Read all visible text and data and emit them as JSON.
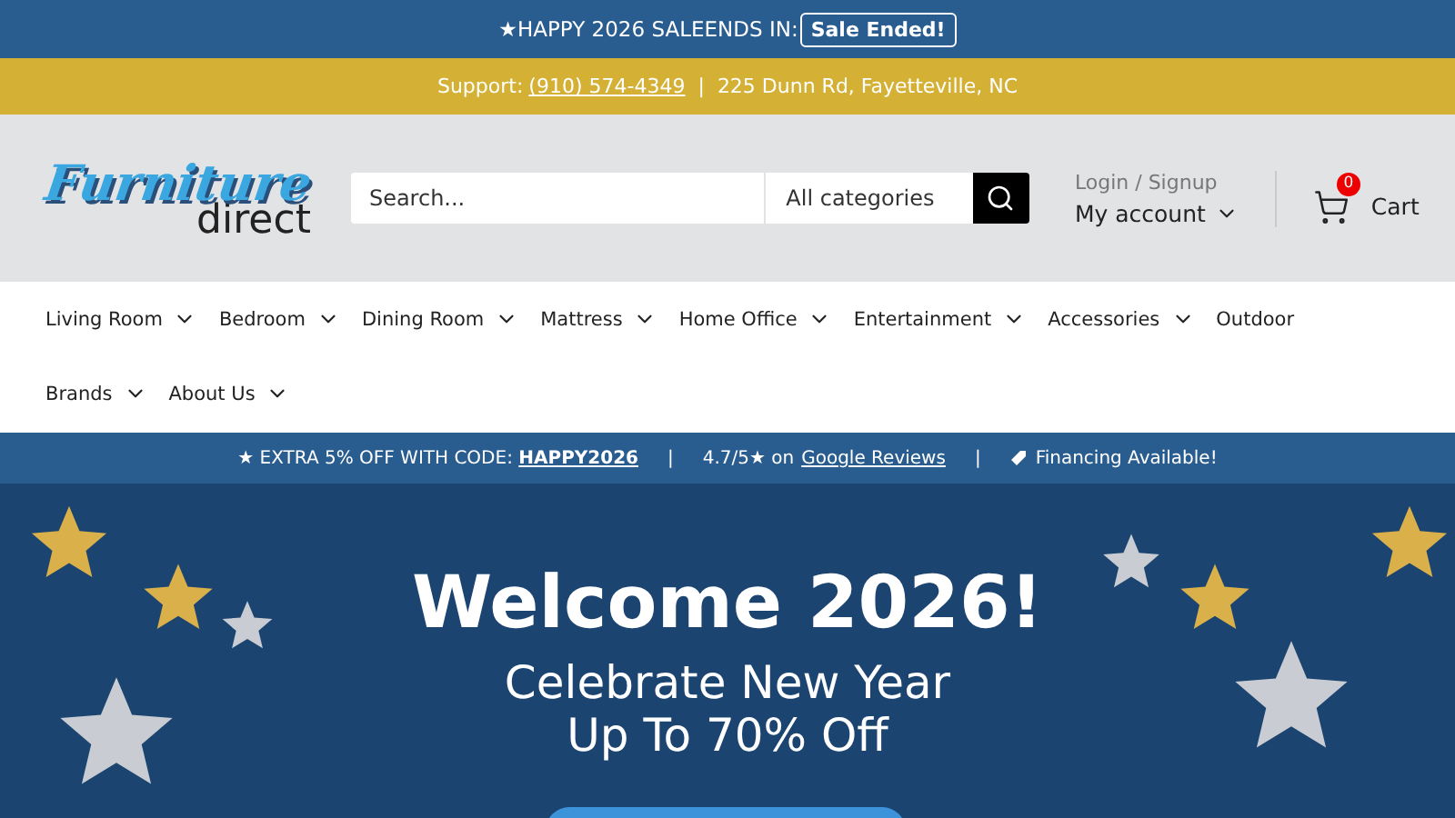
{
  "announcement": {
    "text": "★HAPPY 2026 SALEENDS IN:",
    "badge": "Sale Ended!"
  },
  "support_bar": {
    "label": "Support:",
    "phone": "(910) 574-4349",
    "separator": "|",
    "address": "225 Dunn Rd, Fayetteville, NC"
  },
  "header": {
    "logo": {
      "word_1": "Furniture",
      "word_2": "direct"
    },
    "search": {
      "placeholder": "Search...",
      "category": "All categories"
    },
    "account": {
      "login": "Login / Signup",
      "label": "My account"
    },
    "cart": {
      "count": "0",
      "label": "Cart"
    }
  },
  "nav": [
    {
      "label": "Living Room",
      "dropdown": true
    },
    {
      "label": "Bedroom",
      "dropdown": true
    },
    {
      "label": "Dining Room",
      "dropdown": true
    },
    {
      "label": "Mattress",
      "dropdown": true
    },
    {
      "label": "Home Office",
      "dropdown": true
    },
    {
      "label": "Entertainment",
      "dropdown": true
    },
    {
      "label": "Accessories",
      "dropdown": true
    },
    {
      "label": "Outdoor",
      "dropdown": false
    },
    {
      "label": "Brands",
      "dropdown": true
    },
    {
      "label": "About Us",
      "dropdown": true
    }
  ],
  "promo_bar": {
    "code_text": "★ EXTRA 5% OFF WITH CODE:",
    "code": "HAPPY2026",
    "separator_1": "|",
    "rating": "4.7/5★ on",
    "reviews_link": "Google Reviews",
    "separator_2": "|",
    "financing": "Financing Available!"
  },
  "hero": {
    "title": "Welcome 2026!",
    "subtitle_1": "Celebrate New Year",
    "subtitle_2": "Up To 70% Off"
  }
}
